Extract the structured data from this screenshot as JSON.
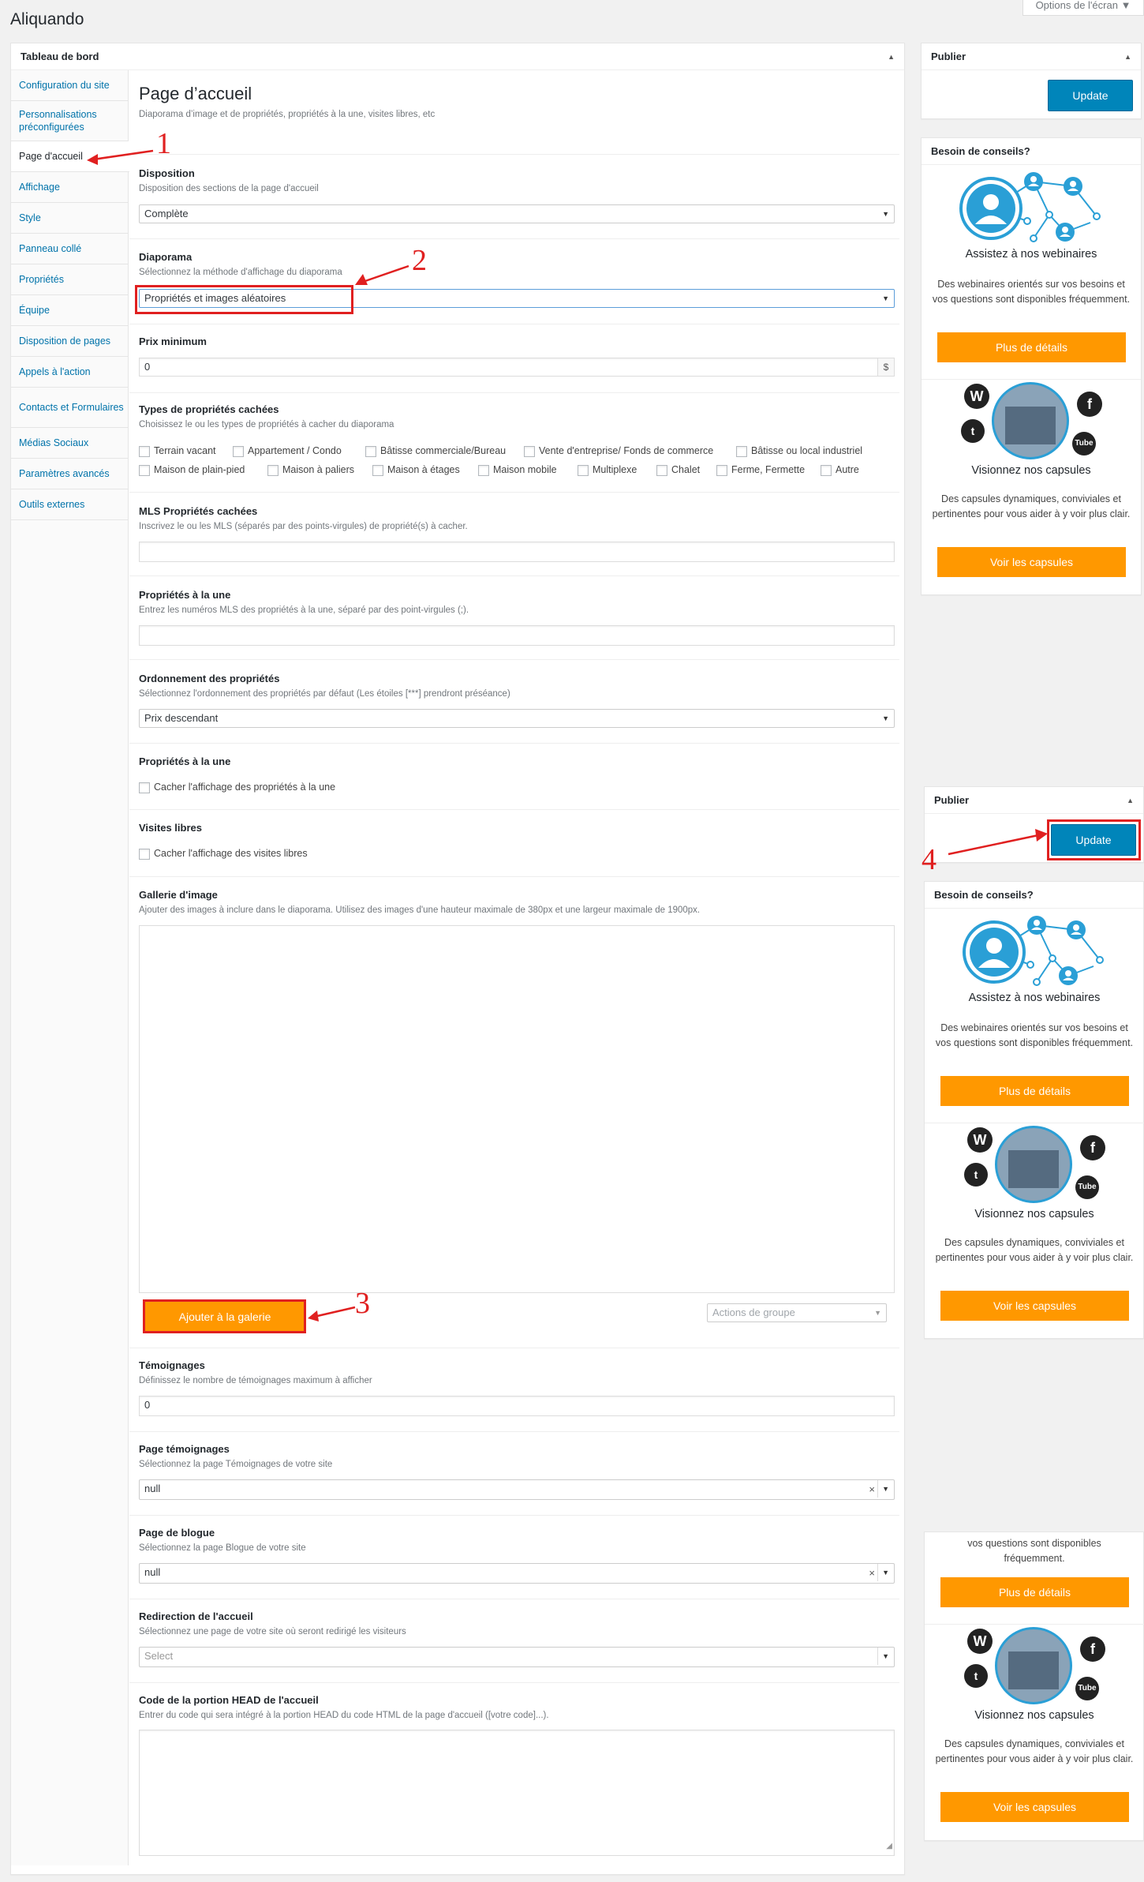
{
  "header": {
    "app_title": "Aliquando",
    "screen_options": "Options de l'écran"
  },
  "main_panel": {
    "title": "Tableau de bord"
  },
  "nav": [
    {
      "label": "Configuration du site"
    },
    {
      "label": "Personnalisations préconfigurées"
    },
    {
      "label": "Page d'accueil"
    },
    {
      "label": "Affichage"
    },
    {
      "label": "Style"
    },
    {
      "label": "Panneau collé"
    },
    {
      "label": "Propriétés"
    },
    {
      "label": "Équipe"
    },
    {
      "label": "Disposition de pages"
    },
    {
      "label": "Appels à l'action"
    },
    {
      "label": "Contacts et Formulaires"
    },
    {
      "label": "Médias Sociaux"
    },
    {
      "label": "Paramètres avancés"
    },
    {
      "label": "Outils externes"
    }
  ],
  "page": {
    "title": "Page d’accueil",
    "subtitle": "Diaporama d’image et de propriétés, propriétés à la une, visites libres, etc"
  },
  "sections": {
    "disposition": {
      "label": "Disposition",
      "desc": "Disposition des sections de la page d'accueil",
      "value": "Complète"
    },
    "diaporama": {
      "label": "Diaporama",
      "desc": "Sélectionnez la méthode d'affichage du diaporama",
      "value": "Propriétés et images aléatoires"
    },
    "prix": {
      "label": "Prix minimum",
      "value": "0",
      "unit": "$"
    },
    "types": {
      "label": "Types de propriétés cachées",
      "desc": "Choisissez le ou les types de propriétés à cacher du diaporama",
      "row1": [
        "Terrain vacant",
        "Appartement / Condo",
        "Bâtisse commerciale/Bureau",
        "Vente d'entreprise/ Fonds de commerce",
        "Bâtisse ou local industriel"
      ],
      "row2": [
        "Maison de plain-pied",
        "Maison à paliers",
        "Maison à étages",
        "Maison mobile",
        "Multiplexe",
        "Chalet",
        "Ferme, Fermette",
        "Autre"
      ]
    },
    "mls": {
      "label": "MLS Propriétés cachées",
      "desc": "Inscrivez le ou les MLS (séparés par des points-virgules) de propriété(s) à cacher."
    },
    "une": {
      "label": "Propriétés à la une",
      "desc": "Entrez les numéros MLS des propriétés à la une, séparé par des point-virgules (;)."
    },
    "ordre": {
      "label": "Ordonnement des propriétés",
      "desc": "Sélectionnez l'ordonnement des propriétés par défaut (Les étoiles [***] prendront préséance)",
      "value": "Prix descendant"
    },
    "une2": {
      "label": "Propriétés à la une",
      "checkbox": "Cacher l'affichage des propriétés à la une"
    },
    "visites": {
      "label": "Visites libres",
      "checkbox": "Cacher l'affichage des visites libres"
    },
    "galerie": {
      "label": "Gallerie d'image",
      "desc": "Ajouter des images à inclure dans le diaporama. Utilisez des images d'une hauteur maximale de 380px et une largeur maximale de 1900px.",
      "add_button": "Ajouter à la galerie",
      "bulk": "Actions de groupe"
    },
    "temoignages": {
      "label": "Témoignages",
      "desc": "Définissez le nombre de témoignages maximum à afficher",
      "value": "0"
    },
    "page_temoignages": {
      "label": "Page témoignages",
      "desc": "Sélectionnez la page Témoignages de votre site",
      "value": "null"
    },
    "page_blogue": {
      "label": "Page de blogue",
      "desc": "Sélectionnez la page Blogue de votre site",
      "value": "null"
    },
    "redirection": {
      "label": "Redirection de l'accueil",
      "desc": "Sélectionnez une page de votre site où seront redirigé les visiteurs",
      "placeholder": "Select"
    },
    "head": {
      "label": "Code de la portion HEAD de l'accueil",
      "desc": "Entrer du code qui sera intégré à la portion HEAD du code HTML de la page d'accueil ([votre code]...)."
    }
  },
  "sidebar": {
    "publish_title": "Publier",
    "update": "Update",
    "help_title": "Besoin de conseils?",
    "webinar_title": "Assistez à nos webinaires",
    "webinar_text": "Des webinaires orientés sur vos besoins et vos questions sont disponibles fréquemment.",
    "webinar_btn": "Plus de détails",
    "video_title": "Visionnez nos capsules",
    "video_text": "Des capsules dynamiques, conviviales et pertinentes pour vous aider à y voir plus clair.",
    "video_btn": "Voir les capsules",
    "partial_text": "vos questions sont disponibles fréquemment."
  },
  "annotations": [
    "1",
    "2",
    "3",
    "4"
  ],
  "colors": {
    "accent_blue": "#0085ba",
    "orange": "#ff9800",
    "annotation_red": "#e02020",
    "link": "#0073aa"
  }
}
